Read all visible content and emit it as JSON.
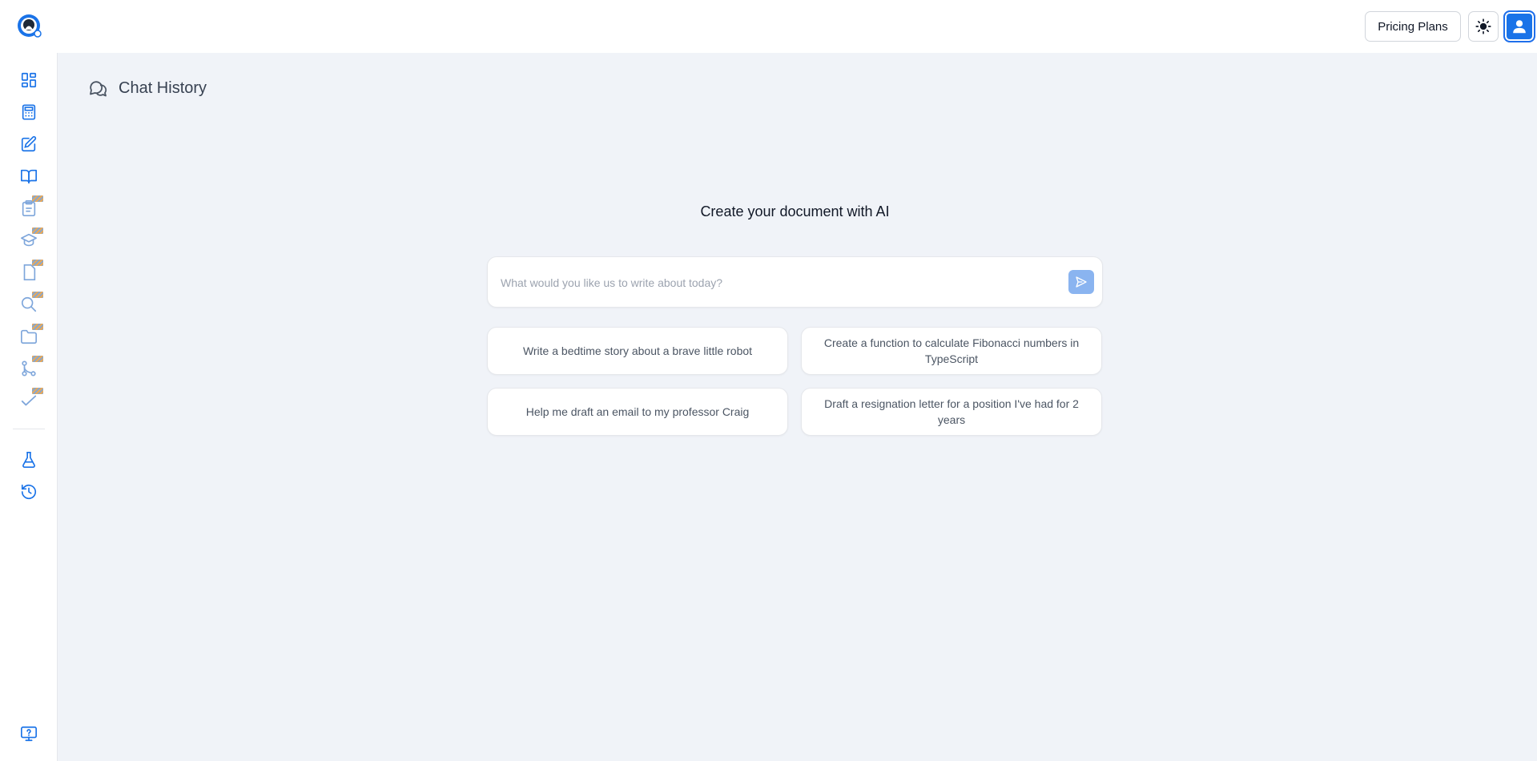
{
  "header": {
    "pricing_label": "Pricing Plans",
    "theme_icon": "sun-icon",
    "avatar_icon": "user-icon"
  },
  "sidebar": {
    "items": [
      {
        "name": "dashboard",
        "icon": "grid-icon",
        "beta": false
      },
      {
        "name": "calculator",
        "icon": "calculator-icon",
        "beta": false
      },
      {
        "name": "editor",
        "icon": "pencil-square-icon",
        "beta": false
      },
      {
        "name": "library",
        "icon": "open-book-icon",
        "beta": false
      },
      {
        "name": "clipboard",
        "icon": "clipboard-icon",
        "beta": true
      },
      {
        "name": "education",
        "icon": "graduation-cap-icon",
        "beta": true
      },
      {
        "name": "document",
        "icon": "document-icon",
        "beta": true
      },
      {
        "name": "search",
        "icon": "search-icon",
        "beta": true
      },
      {
        "name": "folder",
        "icon": "folder-icon",
        "beta": true
      },
      {
        "name": "workflow",
        "icon": "git-branch-icon",
        "beta": true
      },
      {
        "name": "check",
        "icon": "check-icon",
        "beta": true
      },
      {
        "name": "lab",
        "icon": "flask-icon",
        "beta": false
      },
      {
        "name": "history",
        "icon": "history-icon",
        "beta": false
      },
      {
        "name": "screen-help",
        "icon": "monitor-help-icon",
        "beta": false
      }
    ]
  },
  "main": {
    "section_title": "Chat History",
    "headline": "Create your document with AI",
    "prompt": {
      "placeholder": "What would you like us to write about today?",
      "value": ""
    },
    "suggestions": [
      "Write a bedtime story about a brave little robot",
      "Create a function to calculate Fibonacci numbers in TypeScript",
      "Help me draft an email to my professor Craig",
      "Draft a resignation letter for a position I've had for 2 years"
    ]
  },
  "colors": {
    "accent": "#1a73e8",
    "background": "#f0f3f8",
    "send_button": "#8ab4f0"
  }
}
